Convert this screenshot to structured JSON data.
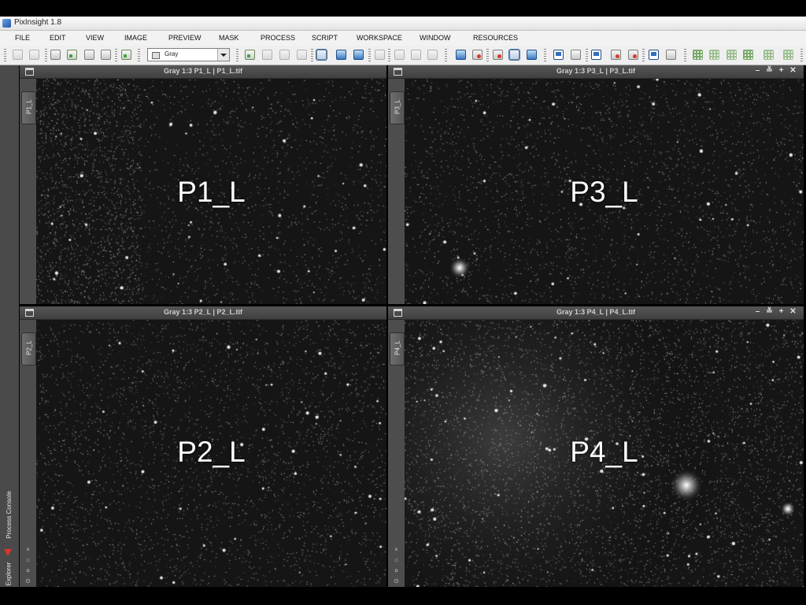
{
  "app": {
    "title": "PixInsight 1.8"
  },
  "menu": [
    "FILE",
    "EDIT",
    "VIEW",
    "IMAGE",
    "PREVIEW",
    "MASK",
    "PROCESS",
    "SCRIPT",
    "WORKSPACE",
    "WINDOW",
    "RESOURCES"
  ],
  "toolbar": {
    "view_select_value": "Gray"
  },
  "side_panel": {
    "process_console": "Process Console",
    "explorer": "Explorer"
  },
  "windows": {
    "p1": {
      "title": "Gray 1:3 P1_L | P1_L.tif",
      "id": "P1_L",
      "label": "P1_L"
    },
    "p3": {
      "title": "Gray 1:3 P3_L | P3_L.tif",
      "id": "P3_L",
      "label": "P3_L"
    },
    "p2": {
      "title": "Gray 1:3 P2_L | P2_L.tif",
      "id": "P2_L",
      "label": "P2_L"
    },
    "p4": {
      "title": "Gray 1:3 P4_L | P4_L.tif",
      "id": "P4_L",
      "label": "P4_L"
    }
  },
  "window_controls": {
    "minimize": "–",
    "shade": "≚",
    "maximize": "+",
    "close": "✕"
  },
  "colors": {
    "image_background": "#141414",
    "panel": "#4a4a4a",
    "accent_red": "#d9362b"
  }
}
